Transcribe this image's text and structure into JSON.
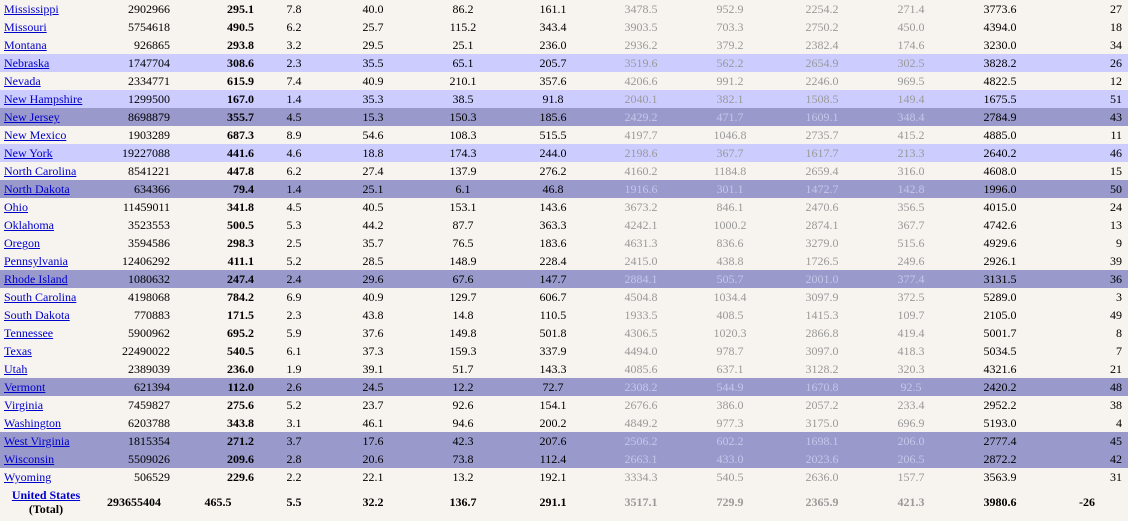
{
  "rows": [
    {
      "state": "Mississippi",
      "pop": "2902966",
      "total": "295.1",
      "c1": "7.8",
      "c2": "40.0",
      "c3": "86.2",
      "c4": "161.1",
      "p1": "3478.5",
      "p2": "952.9",
      "p3": "2254.2",
      "p4": "271.4",
      "ptot": "3773.6",
      "rank": "27",
      "hl": ""
    },
    {
      "state": "Missouri",
      "pop": "5754618",
      "total": "490.5",
      "c1": "6.2",
      "c2": "25.7",
      "c3": "115.2",
      "c4": "343.4",
      "p1": "3903.5",
      "p2": "703.3",
      "p3": "2750.2",
      "p4": "450.0",
      "ptot": "4394.0",
      "rank": "18",
      "hl": ""
    },
    {
      "state": "Montana",
      "pop": "926865",
      "total": "293.8",
      "c1": "3.2",
      "c2": "29.5",
      "c3": "25.1",
      "c4": "236.0",
      "p1": "2936.2",
      "p2": "379.2",
      "p3": "2382.4",
      "p4": "174.6",
      "ptot": "3230.0",
      "rank": "34",
      "hl": ""
    },
    {
      "state": "Nebraska",
      "pop": "1747704",
      "total": "308.6",
      "c1": "2.3",
      "c2": "35.5",
      "c3": "65.1",
      "c4": "205.7",
      "p1": "3519.6",
      "p2": "562.2",
      "p3": "2654.9",
      "p4": "302.5",
      "ptot": "3828.2",
      "rank": "26",
      "hl": "l"
    },
    {
      "state": "Nevada",
      "pop": "2334771",
      "total": "615.9",
      "c1": "7.4",
      "c2": "40.9",
      "c3": "210.1",
      "c4": "357.6",
      "p1": "4206.6",
      "p2": "991.2",
      "p3": "2246.0",
      "p4": "969.5",
      "ptot": "4822.5",
      "rank": "12",
      "hl": ""
    },
    {
      "state": "New Hampshire",
      "pop": "1299500",
      "total": "167.0",
      "c1": "1.4",
      "c2": "35.3",
      "c3": "38.5",
      "c4": "91.8",
      "p1": "2040.1",
      "p2": "382.1",
      "p3": "1508.5",
      "p4": "149.4",
      "ptot": "1675.5",
      "rank": "51",
      "hl": "l"
    },
    {
      "state": "New Jersey",
      "pop": "8698879",
      "total": "355.7",
      "c1": "4.5",
      "c2": "15.3",
      "c3": "150.3",
      "c4": "185.6",
      "p1": "2429.2",
      "p2": "471.7",
      "p3": "1609.1",
      "p4": "348.4",
      "ptot": "2784.9",
      "rank": "43",
      "hl": "d"
    },
    {
      "state": "New Mexico",
      "pop": "1903289",
      "total": "687.3",
      "c1": "8.9",
      "c2": "54.6",
      "c3": "108.3",
      "c4": "515.5",
      "p1": "4197.7",
      "p2": "1046.8",
      "p3": "2735.7",
      "p4": "415.2",
      "ptot": "4885.0",
      "rank": "11",
      "hl": ""
    },
    {
      "state": "New York",
      "pop": "19227088",
      "total": "441.6",
      "c1": "4.6",
      "c2": "18.8",
      "c3": "174.3",
      "c4": "244.0",
      "p1": "2198.6",
      "p2": "367.7",
      "p3": "1617.7",
      "p4": "213.3",
      "ptot": "2640.2",
      "rank": "46",
      "hl": "l"
    },
    {
      "state": "North Carolina",
      "pop": "8541221",
      "total": "447.8",
      "c1": "6.2",
      "c2": "27.4",
      "c3": "137.9",
      "c4": "276.2",
      "p1": "4160.2",
      "p2": "1184.8",
      "p3": "2659.4",
      "p4": "316.0",
      "ptot": "4608.0",
      "rank": "15",
      "hl": ""
    },
    {
      "state": "North Dakota",
      "pop": "634366",
      "total": "79.4",
      "c1": "1.4",
      "c2": "25.1",
      "c3": "6.1",
      "c4": "46.8",
      "p1": "1916.6",
      "p2": "301.1",
      "p3": "1472.7",
      "p4": "142.8",
      "ptot": "1996.0",
      "rank": "50",
      "hl": "d"
    },
    {
      "state": "Ohio",
      "pop": "11459011",
      "total": "341.8",
      "c1": "4.5",
      "c2": "40.5",
      "c3": "153.1",
      "c4": "143.6",
      "p1": "3673.2",
      "p2": "846.1",
      "p3": "2470.6",
      "p4": "356.5",
      "ptot": "4015.0",
      "rank": "24",
      "hl": ""
    },
    {
      "state": "Oklahoma",
      "pop": "3523553",
      "total": "500.5",
      "c1": "5.3",
      "c2": "44.2",
      "c3": "87.7",
      "c4": "363.3",
      "p1": "4242.1",
      "p2": "1000.2",
      "p3": "2874.1",
      "p4": "367.7",
      "ptot": "4742.6",
      "rank": "13",
      "hl": ""
    },
    {
      "state": "Oregon",
      "pop": "3594586",
      "total": "298.3",
      "c1": "2.5",
      "c2": "35.7",
      "c3": "76.5",
      "c4": "183.6",
      "p1": "4631.3",
      "p2": "836.6",
      "p3": "3279.0",
      "p4": "515.6",
      "ptot": "4929.6",
      "rank": "9",
      "hl": ""
    },
    {
      "state": "Pennsylvania",
      "pop": "12406292",
      "total": "411.1",
      "c1": "5.2",
      "c2": "28.5",
      "c3": "148.9",
      "c4": "228.4",
      "p1": "2415.0",
      "p2": "438.8",
      "p3": "1726.5",
      "p4": "249.6",
      "ptot": "2926.1",
      "rank": "39",
      "hl": ""
    },
    {
      "state": "Rhode Island",
      "pop": "1080632",
      "total": "247.4",
      "c1": "2.4",
      "c2": "29.6",
      "c3": "67.6",
      "c4": "147.7",
      "p1": "2884.1",
      "p2": "505.7",
      "p3": "2001.0",
      "p4": "377.4",
      "ptot": "3131.5",
      "rank": "36",
      "hl": "d"
    },
    {
      "state": "South Carolina",
      "pop": "4198068",
      "total": "784.2",
      "c1": "6.9",
      "c2": "40.9",
      "c3": "129.7",
      "c4": "606.7",
      "p1": "4504.8",
      "p2": "1034.4",
      "p3": "3097.9",
      "p4": "372.5",
      "ptot": "5289.0",
      "rank": "3",
      "hl": ""
    },
    {
      "state": "South Dakota",
      "pop": "770883",
      "total": "171.5",
      "c1": "2.3",
      "c2": "43.8",
      "c3": "14.8",
      "c4": "110.5",
      "p1": "1933.5",
      "p2": "408.5",
      "p3": "1415.3",
      "p4": "109.7",
      "ptot": "2105.0",
      "rank": "49",
      "hl": ""
    },
    {
      "state": "Tennessee",
      "pop": "5900962",
      "total": "695.2",
      "c1": "5.9",
      "c2": "37.6",
      "c3": "149.8",
      "c4": "501.8",
      "p1": "4306.5",
      "p2": "1020.3",
      "p3": "2866.8",
      "p4": "419.4",
      "ptot": "5001.7",
      "rank": "8",
      "hl": ""
    },
    {
      "state": "Texas",
      "pop": "22490022",
      "total": "540.5",
      "c1": "6.1",
      "c2": "37.3",
      "c3": "159.3",
      "c4": "337.9",
      "p1": "4494.0",
      "p2": "978.7",
      "p3": "3097.0",
      "p4": "418.3",
      "ptot": "5034.5",
      "rank": "7",
      "hl": ""
    },
    {
      "state": "Utah",
      "pop": "2389039",
      "total": "236.0",
      "c1": "1.9",
      "c2": "39.1",
      "c3": "51.7",
      "c4": "143.3",
      "p1": "4085.6",
      "p2": "637.1",
      "p3": "3128.2",
      "p4": "320.3",
      "ptot": "4321.6",
      "rank": "21",
      "hl": ""
    },
    {
      "state": "Vermont",
      "pop": "621394",
      "total": "112.0",
      "c1": "2.6",
      "c2": "24.5",
      "c3": "12.2",
      "c4": "72.7",
      "p1": "2308.2",
      "p2": "544.9",
      "p3": "1670.8",
      "p4": "92.5",
      "ptot": "2420.2",
      "rank": "48",
      "hl": "d"
    },
    {
      "state": "Virginia",
      "pop": "7459827",
      "total": "275.6",
      "c1": "5.2",
      "c2": "23.7",
      "c3": "92.6",
      "c4": "154.1",
      "p1": "2676.6",
      "p2": "386.0",
      "p3": "2057.2",
      "p4": "233.4",
      "ptot": "2952.2",
      "rank": "38",
      "hl": ""
    },
    {
      "state": "Washington",
      "pop": "6203788",
      "total": "343.8",
      "c1": "3.1",
      "c2": "46.1",
      "c3": "94.6",
      "c4": "200.2",
      "p1": "4849.2",
      "p2": "977.3",
      "p3": "3175.0",
      "p4": "696.9",
      "ptot": "5193.0",
      "rank": "4",
      "hl": ""
    },
    {
      "state": "West Virginia",
      "pop": "1815354",
      "total": "271.2",
      "c1": "3.7",
      "c2": "17.6",
      "c3": "42.3",
      "c4": "207.6",
      "p1": "2506.2",
      "p2": "602.2",
      "p3": "1698.1",
      "p4": "206.0",
      "ptot": "2777.4",
      "rank": "45",
      "hl": "d"
    },
    {
      "state": "Wisconsin",
      "pop": "5509026",
      "total": "209.6",
      "c1": "2.8",
      "c2": "20.6",
      "c3": "73.8",
      "c4": "112.4",
      "p1": "2663.1",
      "p2": "433.0",
      "p3": "2023.6",
      "p4": "206.5",
      "ptot": "2872.2",
      "rank": "42",
      "hl": "d"
    },
    {
      "state": "Wyoming",
      "pop": "506529",
      "total": "229.6",
      "c1": "2.2",
      "c2": "22.1",
      "c3": "13.2",
      "c4": "192.1",
      "p1": "3334.3",
      "p2": "540.5",
      "p3": "2636.0",
      "p4": "157.7",
      "ptot": "3563.9",
      "rank": "31",
      "hl": ""
    }
  ],
  "total": {
    "state_line1": "United States",
    "state_line2": "(Total)",
    "pop": "293655404",
    "total": "465.5",
    "c1": "5.5",
    "c2": "32.2",
    "c3": "136.7",
    "c4": "291.1",
    "p1": "3517.1",
    "p2": "729.9",
    "p3": "2365.9",
    "p4": "421.3",
    "ptot": "3980.6",
    "rank": "-26"
  }
}
